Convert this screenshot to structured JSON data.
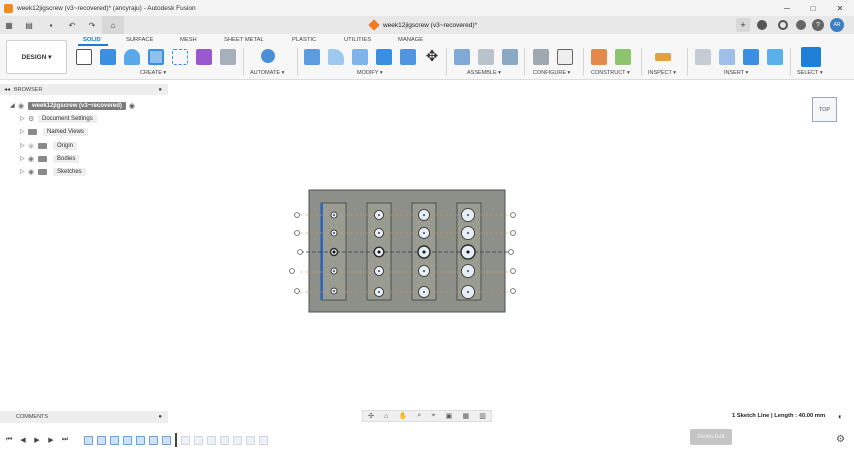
{
  "window": {
    "title": "week12jigscrew (v3~recovered)* (ancyraju) - Autodesk Fusion",
    "min_glyph": "─",
    "max_glyph": "□",
    "close_glyph": "✕"
  },
  "qat": {
    "grid_glyph": "▦",
    "file_glyph": "▤",
    "undo_glyph": "↶",
    "redo_glyph": "↷",
    "home_glyph": "⌂",
    "plus_glyph": "+",
    "user_initials": "AR",
    "help_glyph": "?"
  },
  "document_tab": {
    "label": "week12jigscrew (v3~recovered)*",
    "close_glyph": "✕"
  },
  "ribbon": {
    "design_button": "DESIGN ▾",
    "tabs": [
      "SOLID",
      "SURFACE",
      "MESH",
      "SHEET METAL",
      "PLASTIC",
      "UTILITIES",
      "MANAGE"
    ],
    "groups": [
      "CREATE ▾",
      "AUTOMATE ▾",
      "MODIFY ▾",
      "ASSEMBLE ▾",
      "CONFIGURE ▾",
      "CONSTRUCT ▾",
      "INSPECT ▾",
      "INSERT ▾",
      "SELECT ▾"
    ],
    "accent": "#1a7ad4"
  },
  "browser": {
    "title": "BROWSER",
    "root": "week12jigscrew (v3~recovered)",
    "items": [
      {
        "label": "Document Settings",
        "icon": "gear-icon"
      },
      {
        "label": "Named Views",
        "icon": "folder-icon"
      },
      {
        "label": "Origin",
        "icon": "folder-icon"
      },
      {
        "label": "Bodies",
        "icon": "folder-icon"
      },
      {
        "label": "Sketches",
        "icon": "folder-icon"
      }
    ]
  },
  "viewcube": {
    "face": "TOP"
  },
  "comments": {
    "label": "COMMENTS"
  },
  "status": {
    "selection_info": "1 Sketch Line | Length : 40.00 mm"
  },
  "timeline": {
    "finish_button": "Finish Edit"
  },
  "colors": {
    "plate": "#8c9088",
    "plate_edge": "#4c4f4c",
    "slot": "#9a9c92",
    "selected_line": "#2266dd",
    "constraint": "#e0a060"
  }
}
